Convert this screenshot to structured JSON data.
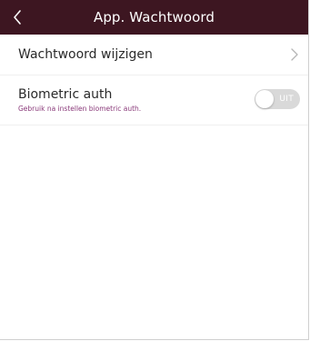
{
  "header": {
    "title": "App. Wachtwoord",
    "back_icon": "chevron-left-icon",
    "background": "#3d1621"
  },
  "settings": {
    "change_password": {
      "label": "Wachtwoord wijzigen",
      "icon": "chevron-right-icon"
    },
    "biometric": {
      "label": "Biometric auth",
      "description": "Gebruik na instellen biometric auth.",
      "toggle_state": "UIT",
      "enabled": false
    }
  },
  "colors": {
    "accent": "#3d1621",
    "description_text": "#8a3a7a",
    "toggle_off": "#d9d9d9"
  }
}
